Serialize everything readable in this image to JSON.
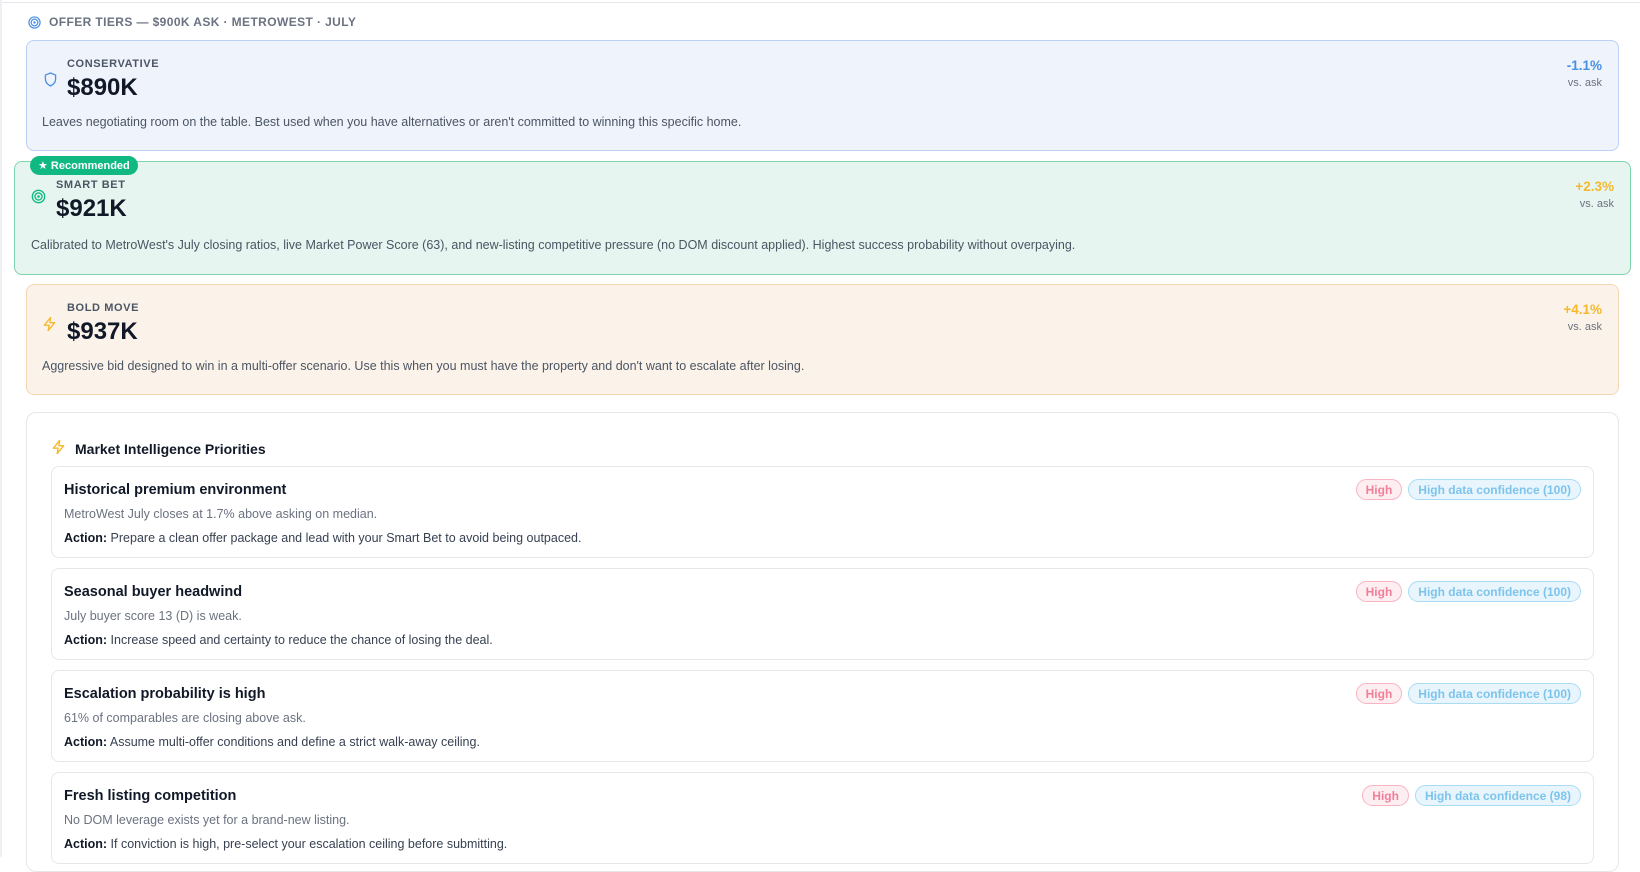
{
  "header": {
    "title": "OFFER TIERS — $900K ASK · METROWEST · JULY",
    "icon": "target-icon"
  },
  "tiers": [
    {
      "id": "conservative",
      "label": "CONSERVATIVE",
      "price": "$890K",
      "pct": "-1.1%",
      "vs": "vs. ask",
      "description": "Leaves negotiating room on the table. Best used when you have alternatives or aren't committed to winning this specific home.",
      "icon": "shield-icon",
      "accent": "#4a90e2"
    },
    {
      "id": "smart-bet",
      "label": "SMART BET",
      "price": "$921K",
      "pct": "+2.3%",
      "vs": "vs. ask",
      "badge": "★ Recommended",
      "description": "Calibrated to MetroWest's July closing ratios, live Market Power Score (63), and new-listing competitive pressure (no DOM discount applied). Highest success probability without overpaying.",
      "icon": "target-icon",
      "accent": "#f5b82e"
    },
    {
      "id": "bold-move",
      "label": "BOLD MOVE",
      "price": "$937K",
      "pct": "+4.1%",
      "vs": "vs. ask",
      "description": "Aggressive bid designed to win in a multi-offer scenario. Use this when you must have the property and don't want to escalate after losing.",
      "icon": "lightning-icon",
      "accent": "#f5b82e"
    }
  ],
  "priorities_panel": {
    "title": "Market Intelligence Priorities",
    "icon": "lightning-icon",
    "action_label": "Action:",
    "items": [
      {
        "title": "Historical premium environment",
        "description": "MetroWest July closes at 1.7% above asking on median.",
        "action": "Prepare a clean offer package and lead with your Smart Bet to avoid being outpaced.",
        "severity": "High",
        "confidence": "High data confidence (100)"
      },
      {
        "title": "Seasonal buyer headwind",
        "description": "July buyer score 13 (D) is weak.",
        "action": "Increase speed and certainty to reduce the chance of losing the deal.",
        "severity": "High",
        "confidence": "High data confidence (100)"
      },
      {
        "title": "Escalation probability is high",
        "description": "61% of comparables are closing above ask.",
        "action": "Assume multi-offer conditions and define a strict walk-away ceiling.",
        "severity": "High",
        "confidence": "High data confidence (100)"
      },
      {
        "title": "Fresh listing competition",
        "description": "No DOM leverage exists yet for a brand-new listing.",
        "action": "If conviction is high, pre-select your escalation ceiling before submitting.",
        "severity": "High",
        "confidence": "High data confidence (98)"
      }
    ]
  }
}
